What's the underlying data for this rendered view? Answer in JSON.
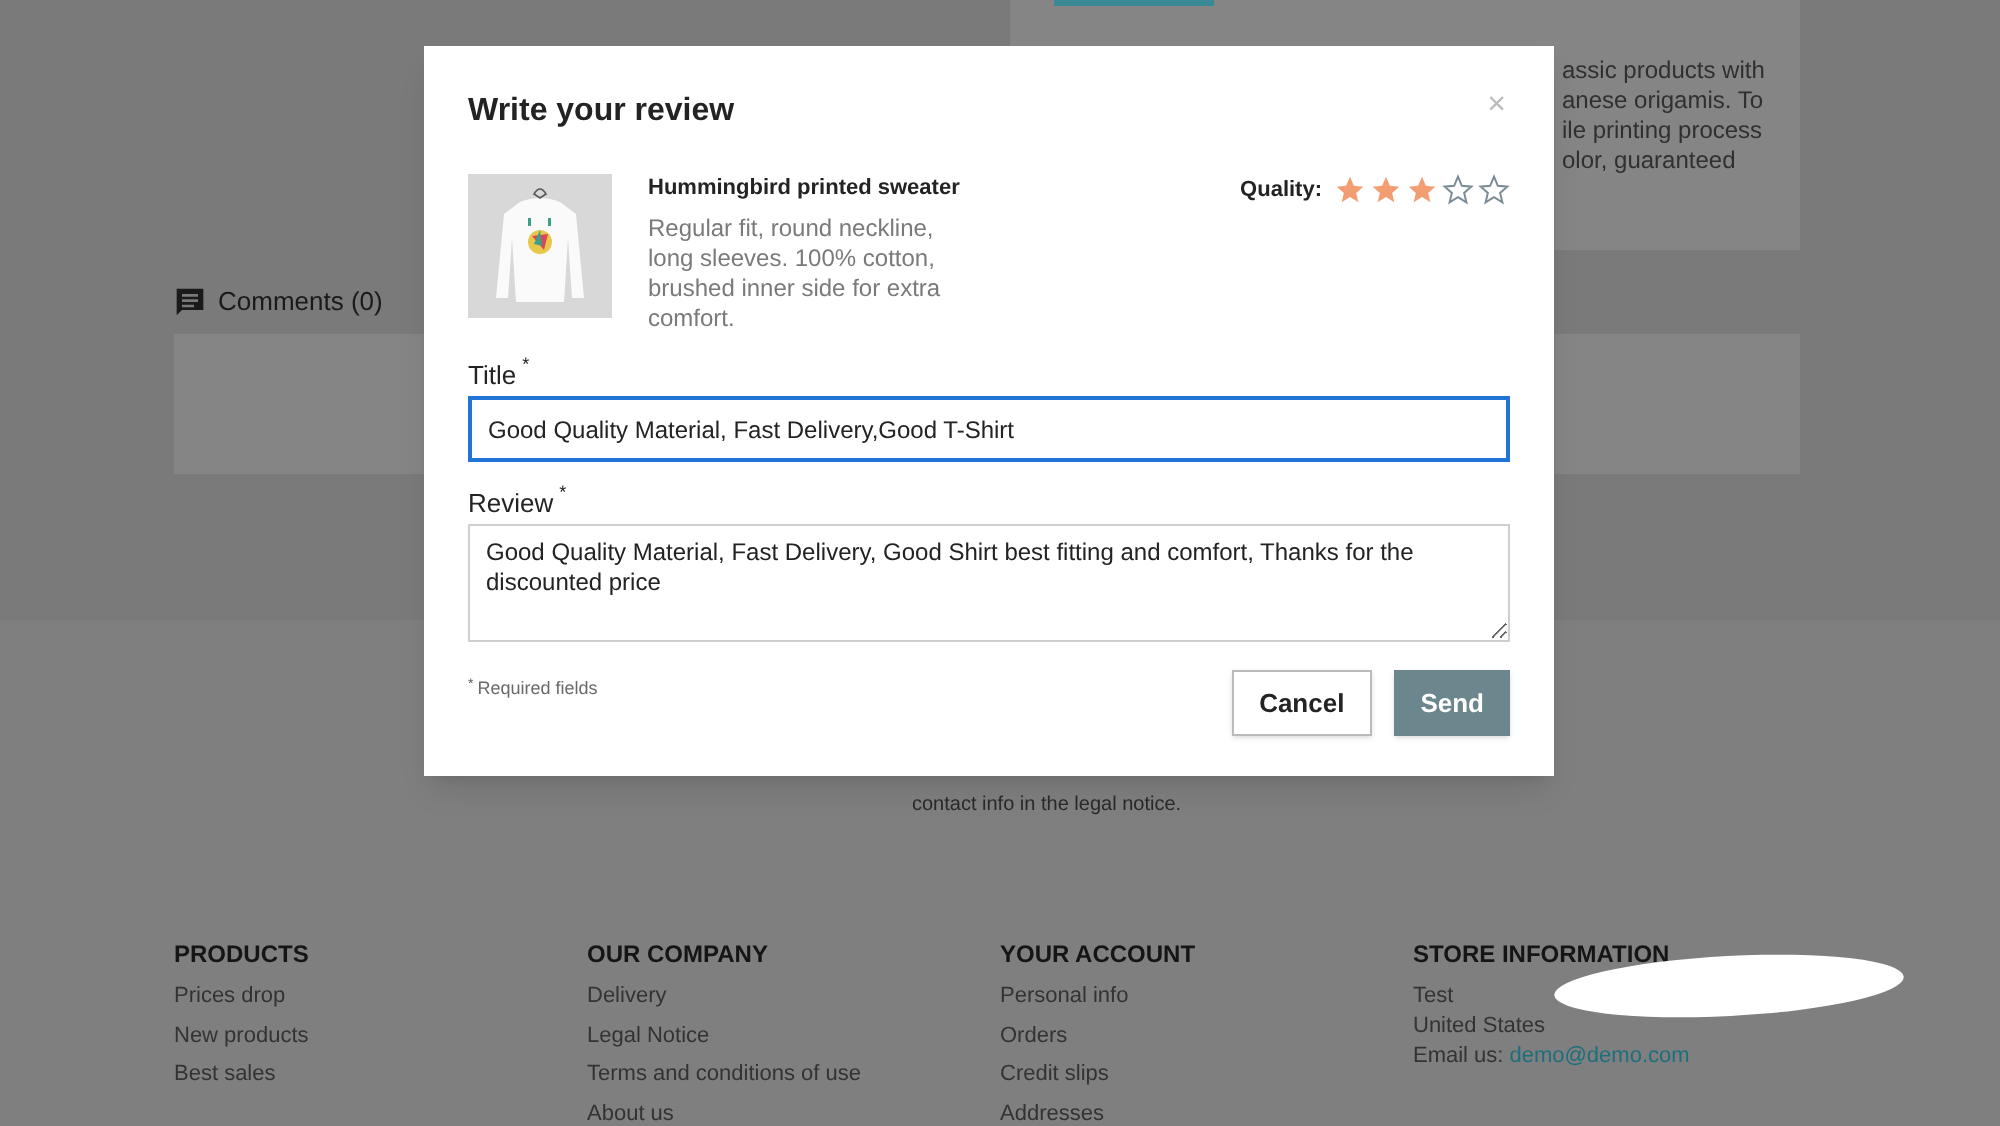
{
  "page": {
    "description_fragments": [
      "assic products with",
      "anese origamis. To",
      "ile printing process",
      "olor, guaranteed"
    ],
    "comments": {
      "label": "Comments (0)"
    },
    "newsletter_note": "contact info in the legal notice.",
    "footer": [
      {
        "heading": "PRODUCTS",
        "links": [
          "Prices drop",
          "New products",
          "Best sales"
        ]
      },
      {
        "heading": "OUR COMPANY",
        "links": [
          "Delivery",
          "Legal Notice",
          "Terms and conditions of use",
          "About us"
        ]
      },
      {
        "heading": "YOUR ACCOUNT",
        "links": [
          "Personal info",
          "Orders",
          "Credit slips",
          "Addresses"
        ]
      },
      {
        "heading": "STORE INFORMATION",
        "lines": [
          "Test",
          "United States"
        ],
        "email_label": "Email us:",
        "email": "demo@demo.com"
      }
    ]
  },
  "modal": {
    "title": "Write your review",
    "close": "×",
    "product": {
      "name": "Hummingbird printed sweater",
      "description": "Regular fit, round neckline, long sleeves. 100% cotton, brushed inner side for extra comfort."
    },
    "rating": {
      "label": "Quality:",
      "stars": 3
    },
    "fields": [
      {
        "label": "Title",
        "required_mark": "*",
        "value": "Good Quality Material, Fast Delivery,Good T-Shirt",
        "focused": true,
        "kind": "input"
      },
      {
        "label": "Review",
        "required_mark": "*",
        "value": "Good Quality Material, Fast Delivery, Good Shirt best fitting and comfort, Thanks for the discounted price",
        "focused": false,
        "kind": "textarea"
      }
    ],
    "required_note": {
      "mark": "*",
      "text": "Required fields"
    },
    "buttons": [
      {
        "label": "Cancel",
        "kind": "secondary"
      },
      {
        "label": "Send",
        "kind": "primary"
      }
    ]
  }
}
